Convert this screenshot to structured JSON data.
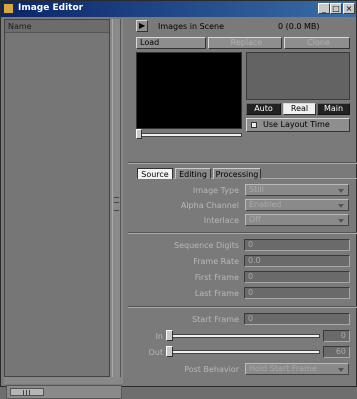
{
  "window": {
    "title": "Image Editor",
    "controls": {
      "minimize": "_",
      "maximize": "□",
      "close": "×"
    }
  },
  "list": {
    "column_header": "Name"
  },
  "header": {
    "menu_arrow": "▶",
    "images_label": "Images in Scene",
    "images_count": "0 (0.0 MB)"
  },
  "toolbar": {
    "load": "Load",
    "replace": "Replace",
    "clone": "Clone"
  },
  "preview": {
    "auto": "Auto",
    "real": "Real",
    "main": "Main",
    "use_layout_time": "Use Layout Time",
    "timeline_position": 0
  },
  "tabs": [
    "Source",
    "Editing",
    "Processing"
  ],
  "source": {
    "image_type_label": "Image Type",
    "image_type_value": "Still",
    "alpha_channel_label": "Alpha Channel",
    "alpha_channel_value": "Enabled",
    "interlace_label": "Interlace",
    "interlace_value": "Off",
    "sequence_digits_label": "Sequence Digits",
    "sequence_digits_value": "0",
    "frame_rate_label": "Frame Rate",
    "frame_rate_value": "0.0",
    "first_frame_label": "First Frame",
    "first_frame_value": "0",
    "last_frame_label": "Last Frame",
    "last_frame_value": "0",
    "start_frame_label": "Start Frame",
    "start_frame_value": "0",
    "in_label": "In",
    "in_value": "0",
    "out_label": "Out",
    "out_value": "60",
    "post_behavior_label": "Post Behavior",
    "post_behavior_value": "Hold Start Frame"
  }
}
